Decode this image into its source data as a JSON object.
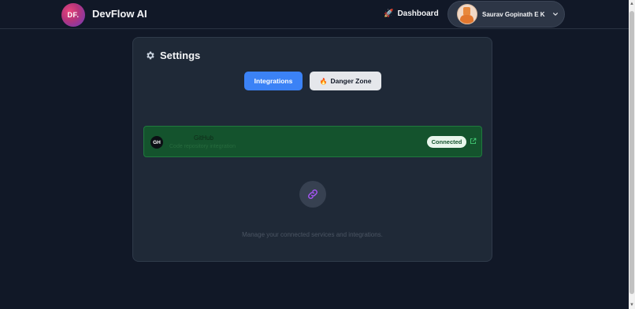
{
  "header": {
    "logo_text": "DF.",
    "brand": "DevFlow AI",
    "dashboard_icon": "rocket-icon",
    "dashboard_label": "Dashboard",
    "user_name": "Saurav Gopinath E K",
    "chevron_icon": "chevron-down-icon"
  },
  "settings": {
    "icon": "gear-icon",
    "title": "Settings",
    "tabs": [
      {
        "label": "Integrations",
        "active": true
      },
      {
        "label": "Danger Zone",
        "icon": "flame-icon",
        "active": false
      }
    ]
  },
  "integrations": [
    {
      "avatar_text": "GH",
      "name": "GitHub",
      "description": "Code repository integration",
      "status": "Connected",
      "link_icon": "external-link-icon"
    }
  ],
  "empty_state": {
    "icon": "link-icon",
    "text": "Manage your connected services and integrations."
  },
  "colors": {
    "background": "#111827",
    "panel": "#1f2937",
    "accent": "#3b82f6",
    "connected_bg": "#14532d",
    "link_icon": "#a855f7"
  }
}
